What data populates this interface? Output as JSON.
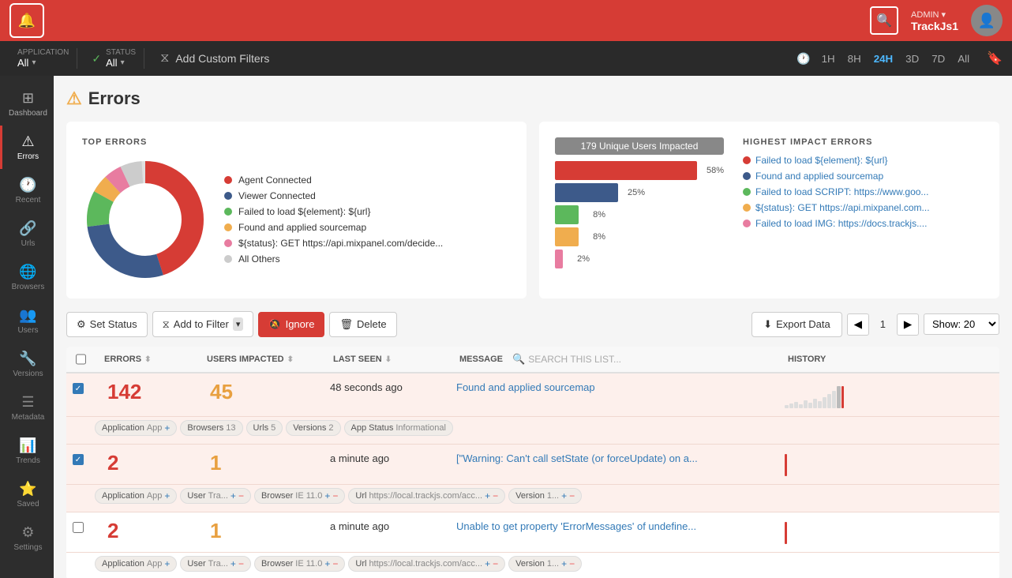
{
  "topbar": {
    "logo_symbol": "🔔",
    "search_label": "🔍",
    "admin_label": "ADMIN ▾",
    "app_name": "TrackJs1",
    "avatar_symbol": "👤"
  },
  "filterbar": {
    "application_label": "APPLICATION",
    "application_value": "All",
    "status_label": "STATUS",
    "status_value": "All",
    "add_filter_label": "Add Custom Filters",
    "time_options": [
      "1H",
      "8H",
      "24H",
      "3D",
      "7D",
      "All"
    ],
    "active_time": "24H"
  },
  "sidebar": {
    "items": [
      {
        "id": "dashboard",
        "label": "Dashboard",
        "icon": "⊞",
        "active": false
      },
      {
        "id": "errors",
        "label": "Errors",
        "icon": "⚠",
        "active": true
      },
      {
        "id": "recent",
        "label": "Recent",
        "icon": "🕐",
        "active": false
      },
      {
        "id": "urls",
        "label": "Urls",
        "icon": "🔗",
        "active": false
      },
      {
        "id": "browsers",
        "label": "Browsers",
        "icon": "🌐",
        "active": false
      },
      {
        "id": "users",
        "label": "Users",
        "icon": "👥",
        "active": false
      },
      {
        "id": "versions",
        "label": "Versions",
        "icon": "🔧",
        "active": false
      },
      {
        "id": "metadata",
        "label": "Metadata",
        "icon": "☰",
        "active": false
      },
      {
        "id": "trends",
        "label": "Trends",
        "icon": "📊",
        "active": false
      },
      {
        "id": "saved",
        "label": "Saved",
        "icon": "⭐",
        "active": false
      },
      {
        "id": "settings",
        "label": "Settings",
        "icon": "⚙",
        "active": false
      }
    ]
  },
  "page": {
    "title": "Errors",
    "warning_icon": "⚠"
  },
  "top_errors_chart": {
    "title": "TOP ERRORS",
    "legend": [
      {
        "color": "#d63c35",
        "label": "Agent Connected"
      },
      {
        "color": "#3d5a8a",
        "label": "Viewer Connected"
      },
      {
        "color": "#5cb85c",
        "label": "Failed to load ${element}: ${url}"
      },
      {
        "color": "#f0ad4e",
        "label": "Found and applied sourcemap"
      },
      {
        "color": "#d63c35",
        "label": "${status}: GET https://api.mixpanel.com/decide..."
      },
      {
        "color": "#ccc",
        "label": "All Others"
      }
    ]
  },
  "impact_chart": {
    "header": "179 Unique Users Impacted",
    "bars": [
      {
        "pct": 58,
        "label": "58%",
        "color": "#d63c35",
        "width": 90
      },
      {
        "pct": 25,
        "label": "25%",
        "color": "#3d5a8a",
        "width": 38
      },
      {
        "pct": 8,
        "label": "8%",
        "color": "#5cb85c",
        "width": 14
      },
      {
        "pct": 8,
        "label": "8%",
        "color": "#f0ad4e",
        "width": 14
      },
      {
        "pct": 2,
        "label": "2%",
        "color": "#e87ca0",
        "width": 4
      }
    ]
  },
  "highest_impact": {
    "title": "HIGHEST IMPACT ERRORS",
    "items": [
      {
        "color": "#d63c35",
        "label": "Failed to load ${element}: ${url}"
      },
      {
        "color": "#3d5a8a",
        "label": "Found and applied sourcemap"
      },
      {
        "color": "#5cb85c",
        "label": "Failed to load SCRIPT: https://www.goo..."
      },
      {
        "color": "#f0ad4e",
        "label": "${status}: GET https://api.mixpanel.com..."
      },
      {
        "color": "#e87ca0",
        "label": "Failed to load IMG: https://docs.trackjs...."
      }
    ]
  },
  "toolbar": {
    "set_status_label": "Set Status",
    "add_filter_label": "Add to Filter",
    "ignore_label": "Ignore",
    "delete_label": "Delete",
    "export_label": "Export Data",
    "page_number": "1",
    "show_label": "Show: 20"
  },
  "table": {
    "headers": [
      "",
      "ERRORS",
      "USERS IMPACTED",
      "LAST SEEN",
      "MESSAGE",
      "HISTORY"
    ],
    "rows": [
      {
        "checked": true,
        "errors": "142",
        "users": "45",
        "last_seen": "48 seconds ago",
        "message": "Found and applied sourcemap",
        "message_link": true,
        "tags": [
          {
            "label": "Application  App",
            "has_plus": true
          },
          {
            "label": "Browsers  13",
            "has_plus": false
          },
          {
            "label": "Urls  5",
            "has_plus": false
          },
          {
            "label": "Versions  2",
            "has_plus": false
          },
          {
            "label": "App Status  Informational",
            "has_plus": false
          }
        ]
      },
      {
        "checked": true,
        "errors": "2",
        "users": "1",
        "last_seen": "a minute ago",
        "message": "[\"Warning: Can't call setState (or forceUpdate) on a...",
        "message_link": true,
        "tags": [
          {
            "label": "Application  App",
            "has_plus": true,
            "has_minus": false
          },
          {
            "label": "User  Tra...",
            "has_plus": true,
            "has_minus": true
          },
          {
            "label": "Browser  IE 11.0",
            "has_plus": true,
            "has_minus": true
          },
          {
            "label": "Url  https://local.trackjs.com/acc...",
            "has_plus": true,
            "has_minus": true
          },
          {
            "label": "Version  1...",
            "has_plus": true,
            "has_minus": true
          }
        ]
      },
      {
        "checked": false,
        "errors": "2",
        "users": "1",
        "last_seen": "a minute ago",
        "message": "Unable to get property 'ErrorMessages' of undefine...",
        "message_link": true,
        "tags": [
          {
            "label": "Application  App",
            "has_plus": true,
            "has_minus": false
          },
          {
            "label": "User  Tra...",
            "has_plus": true,
            "has_minus": true
          },
          {
            "label": "Browser  IE 11.0",
            "has_plus": true,
            "has_minus": true
          },
          {
            "label": "Url  https://local.trackjs.com/acc...",
            "has_plus": true,
            "has_minus": true
          },
          {
            "label": "Version  1...",
            "has_plus": true,
            "has_minus": true
          }
        ]
      }
    ]
  }
}
